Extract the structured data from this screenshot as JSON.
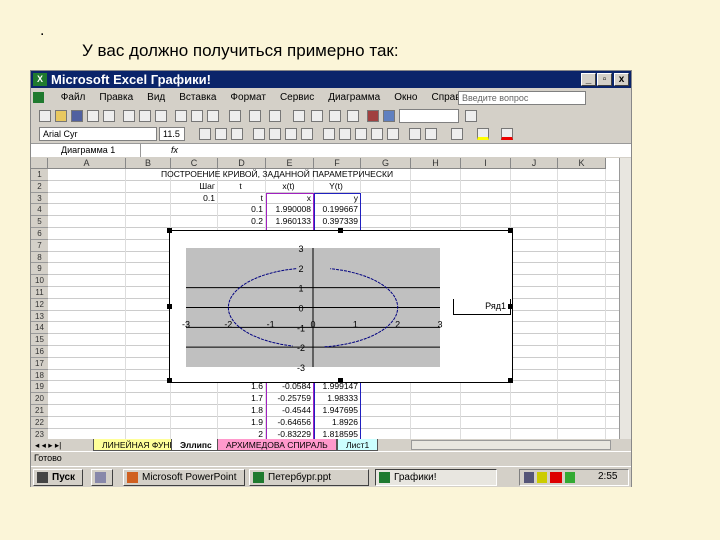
{
  "slide": {
    "bullet": ".",
    "heading": "У вас должно получиться примерно так:"
  },
  "window": {
    "title": "Microsoft Excel   Графики!",
    "min": "_",
    "max": "▫",
    "close": "x"
  },
  "menu": [
    "Файл",
    "Правка",
    "Вид",
    "Вставка",
    "Формат",
    "Сервис",
    "Диаграмма",
    "Окно",
    "Справка"
  ],
  "ask_placeholder": "Введите вопрос",
  "font": {
    "name": "Arial Cyr",
    "size": "11.5"
  },
  "name_box": "Диаграмма 1",
  "fx": "fx",
  "columns": [
    "A",
    "B",
    "C",
    "D",
    "E",
    "F",
    "G",
    "H",
    "I",
    "J",
    "K"
  ],
  "rows": [
    "1",
    "2",
    "3",
    "4",
    "5",
    "6",
    "7",
    "8",
    "9",
    "10",
    "11",
    "12",
    "13",
    "14",
    "15",
    "16",
    "17",
    "18",
    "19",
    "20",
    "21",
    "22",
    "23"
  ],
  "sheet": {
    "title": "ПОСТРОЕНИЕ КРИВОЙ, ЗАДАННОЙ ПАРАМЕТРИЧЕСКИ",
    "row2": {
      "c": "Шаг",
      "d": "t",
      "e": "x(t)",
      "f": "Y(t)"
    },
    "row3": {
      "c": "0.1",
      "d": "t",
      "e": "x",
      "f": "y"
    },
    "data": [
      {
        "row": "4",
        "t": "0.1",
        "x": "1.990008",
        "y": "0.199667"
      },
      {
        "row": "5",
        "t": "0.2",
        "x": "1.960133",
        "y": "0.397339"
      },
      {
        "row": "19",
        "t": "1.6",
        "x": "-0.0584",
        "y": "1.999147"
      },
      {
        "row": "20",
        "t": "1.7",
        "x": "-0.25759",
        "y": "1.98333"
      },
      {
        "row": "21",
        "t": "1.8",
        "x": "-0.4544",
        "y": "1.947695"
      },
      {
        "row": "22",
        "t": "1.9",
        "x": "-0.64656",
        "y": "1.8926"
      },
      {
        "row": "23",
        "t": "2",
        "x": "-0.83229",
        "y": "1.818595"
      }
    ]
  },
  "chart_data": {
    "type": "scatter",
    "series": [
      {
        "name": "Ряд1",
        "x_expr": "2cos(t)",
        "y_expr": "2sin(t)",
        "segments": [
          [
            1.77,
            4.5
          ],
          [
            4.85,
            7.65
          ]
        ]
      }
    ],
    "xlim": [
      -3,
      3
    ],
    "ylim": [
      -3,
      3
    ],
    "xticks": [
      "-3",
      "-2",
      "-1",
      "0",
      "1",
      "2",
      "3"
    ],
    "yticks": [
      "3",
      "2",
      "1",
      "0",
      "-1",
      "-2",
      "-3"
    ],
    "legend": "Ряд1",
    "legend_position": "right",
    "plot_bg": "#c0c0c0"
  },
  "tabs": [
    {
      "label": "◂ ◂ ▸ ▸|"
    },
    {
      "label": "ЛИНЕЙНАЯ ФУНКЦИЯ",
      "color": "#ffff99"
    },
    {
      "label": "Эллипс",
      "color": "#ffffff"
    },
    {
      "label": "АРХИМЕДОВА СПИРАЛЬ",
      "color": "#ff99cc"
    },
    {
      "label": "Лист1",
      "color": "#ccffff"
    }
  ],
  "status": "Готово",
  "taskbar": {
    "start": "Пуск",
    "tasks": [
      "Microsoft PowerPoint",
      "Петербург.ppt",
      "Графики!"
    ],
    "clock": "2:55"
  }
}
